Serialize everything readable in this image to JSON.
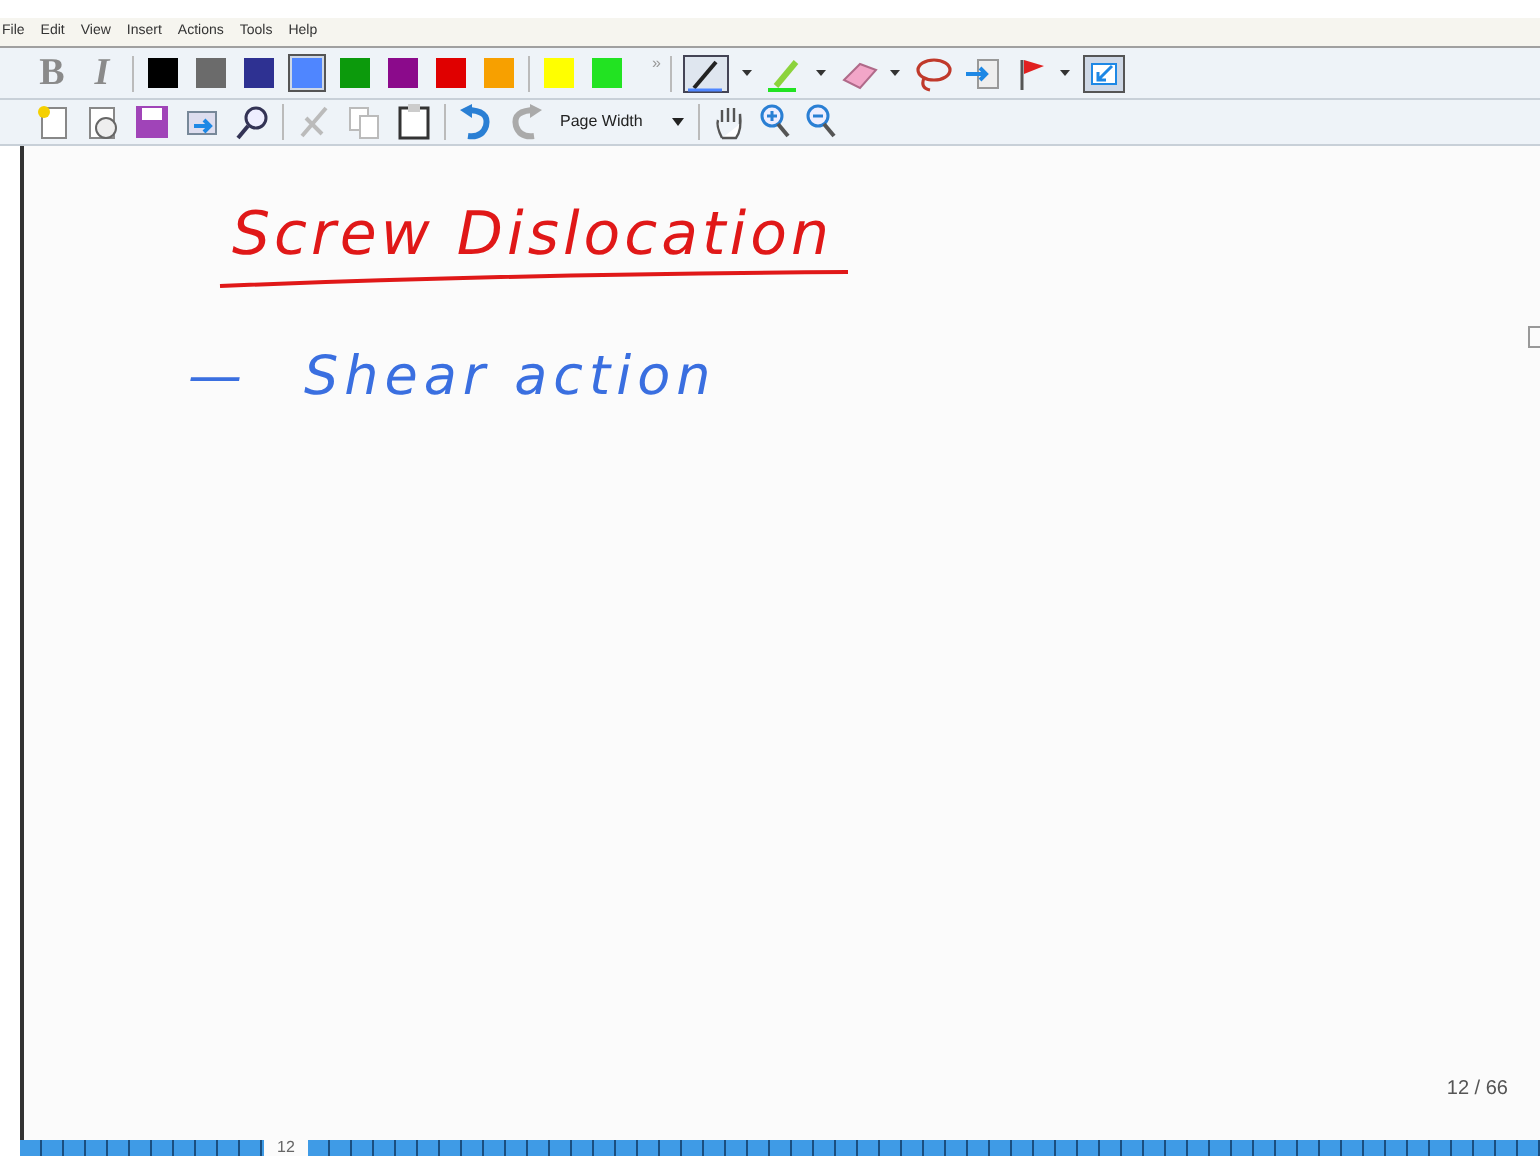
{
  "menu": [
    "File",
    "Edit",
    "View",
    "Insert",
    "Actions",
    "Tools",
    "Help"
  ],
  "toolbar": {
    "format_buttons": [
      "B",
      "I"
    ],
    "swatches": [
      {
        "color": "#000000",
        "selected": false
      },
      {
        "color": "#6b6b6b",
        "selected": false
      },
      {
        "color": "#2e3192",
        "selected": false
      },
      {
        "color": "#4f86ff",
        "selected": true
      },
      {
        "color": "#0c9a0c",
        "selected": false
      },
      {
        "color": "#8b0a8b",
        "selected": false
      },
      {
        "color": "#e00000",
        "selected": false
      },
      {
        "color": "#f7a000",
        "selected": false
      },
      {
        "color": "#ffff00",
        "selected": false
      },
      {
        "color": "#22e322",
        "selected": false
      }
    ],
    "overflow": "»",
    "zoom_dropdown": {
      "value": "Page Width"
    }
  },
  "note": {
    "title": "Screw Dislocation",
    "lines": [
      {
        "bullet": "—",
        "text": "Shear action"
      }
    ]
  },
  "page_indicator": "12 / 66",
  "taskbar": {
    "label": "12"
  }
}
